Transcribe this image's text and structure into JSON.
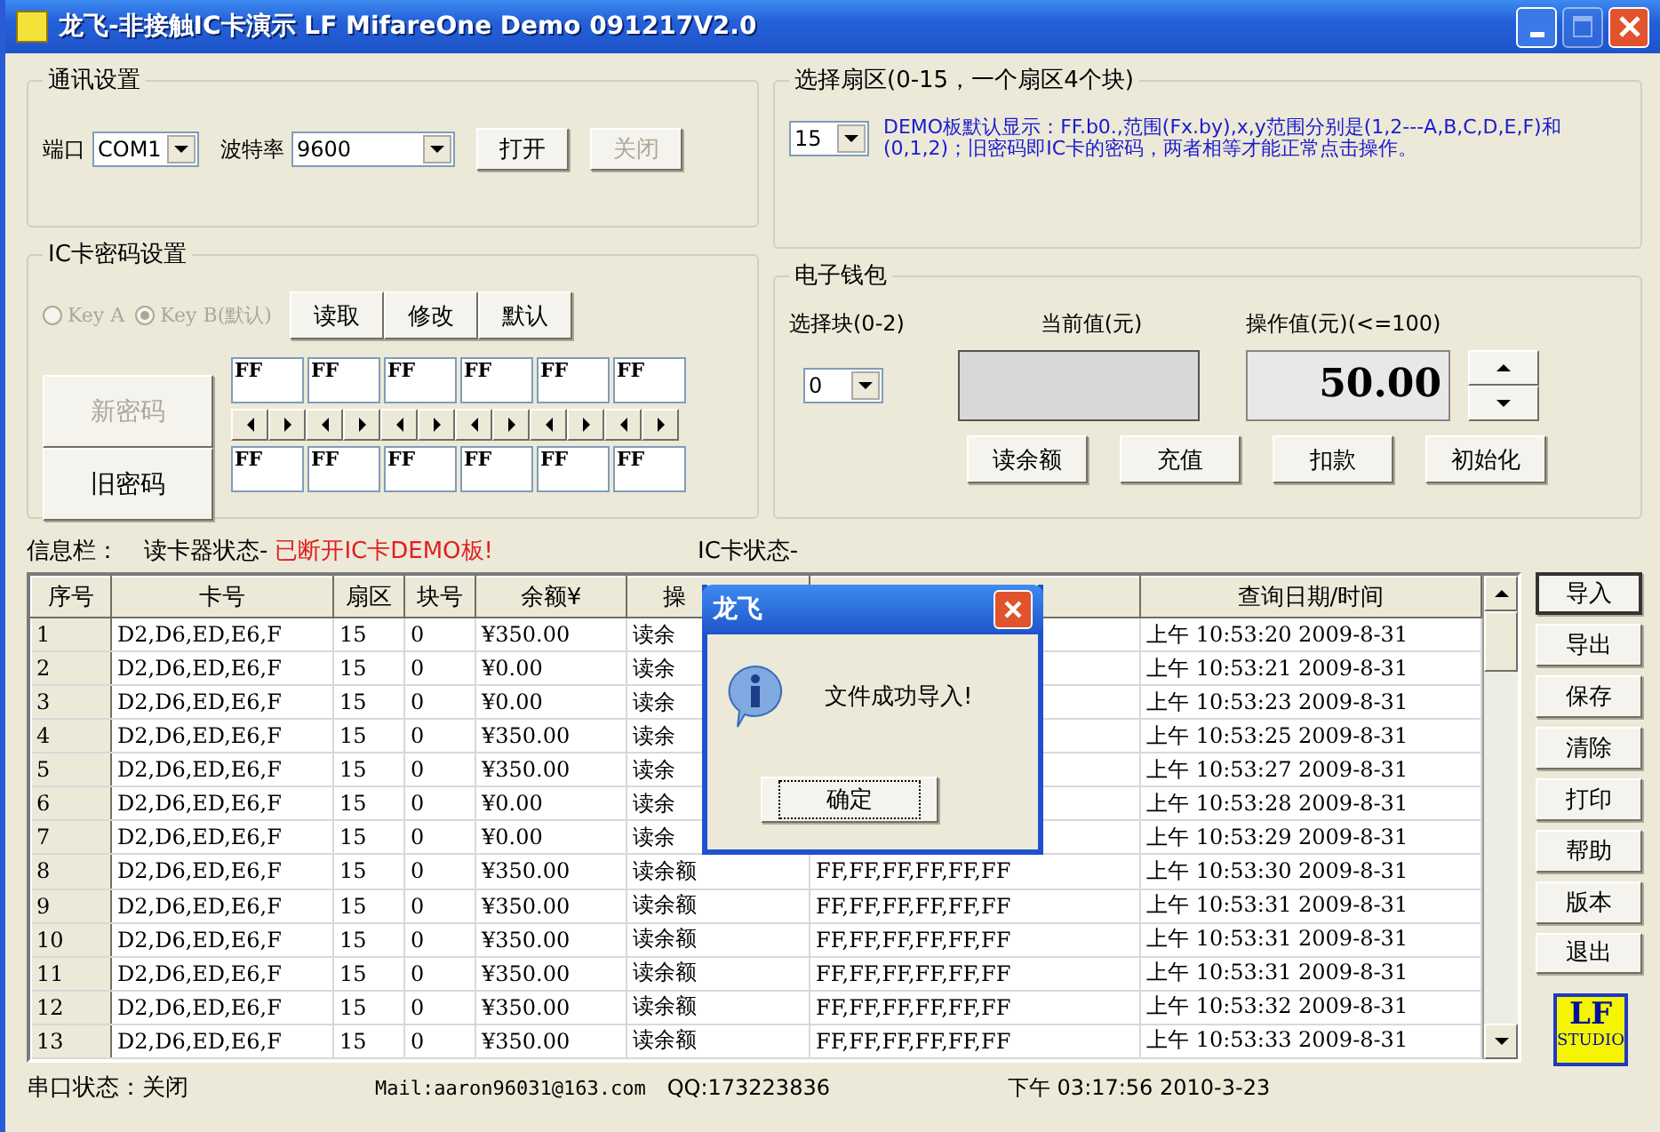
{
  "window": {
    "title": "龙飞-非接触IC卡演示 LF MifareOne Demo 091217V2.0"
  },
  "comm": {
    "title": "通讯设置",
    "port_label": "端口",
    "port": "COM1",
    "baud_label": "波特率",
    "baud": "9600",
    "buttons": [
      {
        "label": "打开",
        "disabled": false
      },
      {
        "label": "关闭",
        "disabled": true
      }
    ]
  },
  "password": {
    "title": "IC卡密码设置",
    "options_disabled": true,
    "key_options": [
      {
        "label": "Key A",
        "selected": false
      },
      {
        "label": "Key B(默认)",
        "selected": true
      }
    ],
    "buttons": [
      "读取",
      "修改",
      "默认"
    ],
    "new_label": "新密码",
    "new_disabled": true,
    "new_bytes": [
      "FF",
      "FF",
      "FF",
      "FF",
      "FF",
      "FF"
    ],
    "old_label": "旧密码",
    "old_bytes": [
      "FF",
      "FF",
      "FF",
      "FF",
      "FF",
      "FF"
    ]
  },
  "sector": {
    "title": "选择扇区(0-15，一个扇区4个块)",
    "value": "15",
    "note": "DEMO板默认显示：FF.b0.,范围(Fx.by),x,y范围分别是(1,2---A,B,C,D,E,F)和(0,1,2)；旧密码即IC卡的密码，两者相等才能正常点击操作。"
  },
  "wallet": {
    "title": "电子钱包",
    "block_label": "选择块(0-2)",
    "block": "0",
    "current_label": "当前值(元)",
    "amount_label": "操作值(元)(<=100)",
    "amount": "50.00",
    "buttons": [
      "读余额",
      "充值",
      "扣款",
      "初始化"
    ]
  },
  "info": {
    "label": "信息栏：",
    "reader_label": "读卡器状态-",
    "reader_status": "已断开IC卡DEMO板!",
    "card_label": "IC卡状态-"
  },
  "table": {
    "columns": [
      "序号",
      "卡号",
      "扇区",
      "块号",
      "余额¥",
      "操",
      null,
      "查询日期/时间"
    ],
    "rows": [
      [
        "1",
        "D2,D6,ED,E6,F",
        "15",
        "0",
        "¥350.00",
        "读余",
        null,
        "上午 10:53:20 2009-8-31"
      ],
      [
        "2",
        "D2,D6,ED,E6,F",
        "15",
        "0",
        "¥0.00",
        "读余",
        null,
        "上午 10:53:21 2009-8-31"
      ],
      [
        "3",
        "D2,D6,ED,E6,F",
        "15",
        "0",
        "¥0.00",
        "读余",
        null,
        "上午 10:53:23 2009-8-31"
      ],
      [
        "4",
        "D2,D6,ED,E6,F",
        "15",
        "0",
        "¥350.00",
        "读余",
        null,
        "上午 10:53:25 2009-8-31"
      ],
      [
        "5",
        "D2,D6,ED,E6,F",
        "15",
        "0",
        "¥350.00",
        "读余",
        null,
        "上午 10:53:27 2009-8-31"
      ],
      [
        "6",
        "D2,D6,ED,E6,F",
        "15",
        "0",
        "¥0.00",
        "读余",
        null,
        "上午 10:53:28 2009-8-31"
      ],
      [
        "7",
        "D2,D6,ED,E6,F",
        "15",
        "0",
        "¥0.00",
        "读余",
        null,
        "上午 10:53:29 2009-8-31"
      ],
      [
        "8",
        "D2,D6,ED,E6,F",
        "15",
        "0",
        "¥350.00",
        "读余额",
        "FF,FF,FF,FF,FF,FF",
        "上午 10:53:30 2009-8-31"
      ],
      [
        "9",
        "D2,D6,ED,E6,F",
        "15",
        "0",
        "¥350.00",
        "读余额",
        "FF,FF,FF,FF,FF,FF",
        "上午 10:53:31 2009-8-31"
      ],
      [
        "10",
        "D2,D6,ED,E6,F",
        "15",
        "0",
        "¥350.00",
        "读余额",
        "FF,FF,FF,FF,FF,FF",
        "上午 10:53:31 2009-8-31"
      ],
      [
        "11",
        "D2,D6,ED,E6,F",
        "15",
        "0",
        "¥350.00",
        "读余额",
        "FF,FF,FF,FF,FF,FF",
        "上午 10:53:31 2009-8-31"
      ],
      [
        "12",
        "D2,D6,ED,E6,F",
        "15",
        "0",
        "¥350.00",
        "读余额",
        "FF,FF,FF,FF,FF,FF",
        "上午 10:53:32 2009-8-31"
      ],
      [
        "13",
        "D2,D6,ED,E6,F",
        "15",
        "0",
        "¥350.00",
        "读余额",
        "FF,FF,FF,FF,FF,FF",
        "上午 10:53:33 2009-8-31"
      ]
    ]
  },
  "side_buttons": [
    "导入",
    "导出",
    "保存",
    "清除",
    "打印",
    "帮助",
    "版本",
    "退出"
  ],
  "logo": {
    "line1": "LF",
    "line2": "STUDIO"
  },
  "dialog": {
    "title": "龙飞",
    "message": "文件成功导入!",
    "button": "确定"
  },
  "status_bar": {
    "serial": "串口状态：关闭",
    "mail": "Mail:aaron96031@163.com",
    "qq": "QQ:173223836",
    "time": "下午 03:17:56 2010-3-23"
  }
}
